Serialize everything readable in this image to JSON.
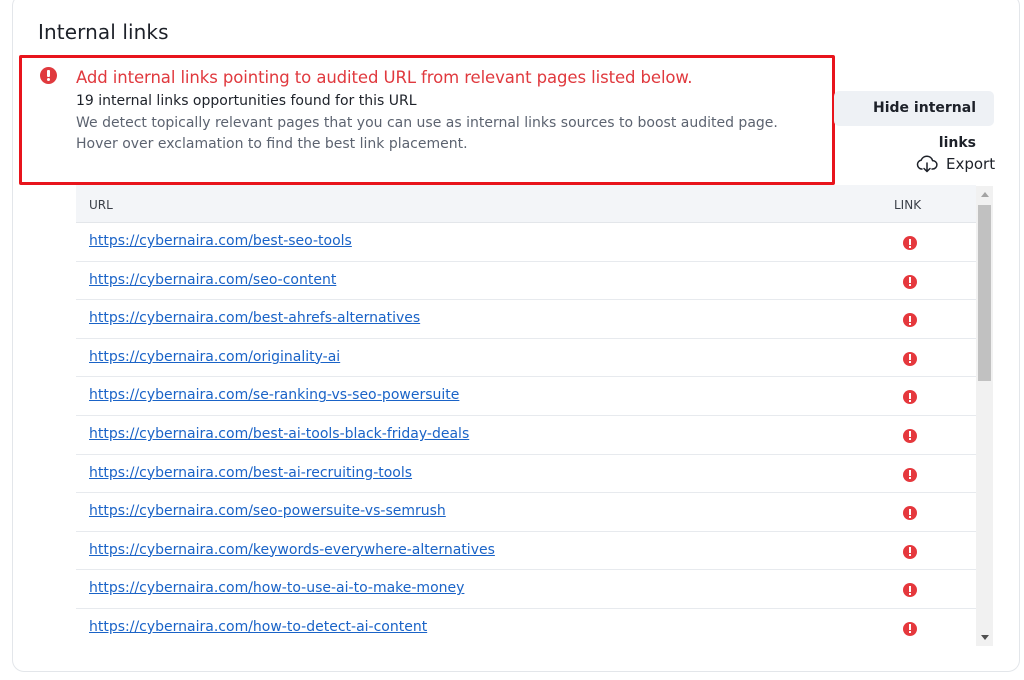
{
  "section": {
    "title": "Internal links"
  },
  "alert": {
    "icon": "exclamation-circle-icon",
    "heading": "Add internal links pointing to audited URL from relevant pages listed below.",
    "subheading": "19 internal links opportunities found for this URL",
    "body": "We detect topically relevant pages that you can use as internal links sources to boost audited page. Hover over exclamation to find the best link placement.",
    "highlight_color": "#e8141c",
    "heading_color": "#e0393e"
  },
  "actions": {
    "hide_label": "Hide internal links",
    "export_label": "Export",
    "export_icon": "download-cloud-icon"
  },
  "table": {
    "columns": [
      "URL",
      "LINK"
    ],
    "link_icon": "exclamation-circle-icon",
    "rows": [
      {
        "url": "https://cybernaira.com/best-seo-tools"
      },
      {
        "url": "https://cybernaira.com/seo-content"
      },
      {
        "url": "https://cybernaira.com/best-ahrefs-alternatives"
      },
      {
        "url": "https://cybernaira.com/originality-ai"
      },
      {
        "url": "https://cybernaira.com/se-ranking-vs-seo-powersuite"
      },
      {
        "url": "https://cybernaira.com/best-ai-tools-black-friday-deals"
      },
      {
        "url": "https://cybernaira.com/best-ai-recruiting-tools"
      },
      {
        "url": "https://cybernaira.com/seo-powersuite-vs-semrush"
      },
      {
        "url": "https://cybernaira.com/keywords-everywhere-alternatives"
      },
      {
        "url": "https://cybernaira.com/how-to-use-ai-to-make-money"
      },
      {
        "url": "https://cybernaira.com/how-to-detect-ai-content"
      }
    ]
  },
  "colors": {
    "link": "#1a63c7",
    "warning": "#e5383d",
    "header_bg": "#f3f5f8"
  }
}
